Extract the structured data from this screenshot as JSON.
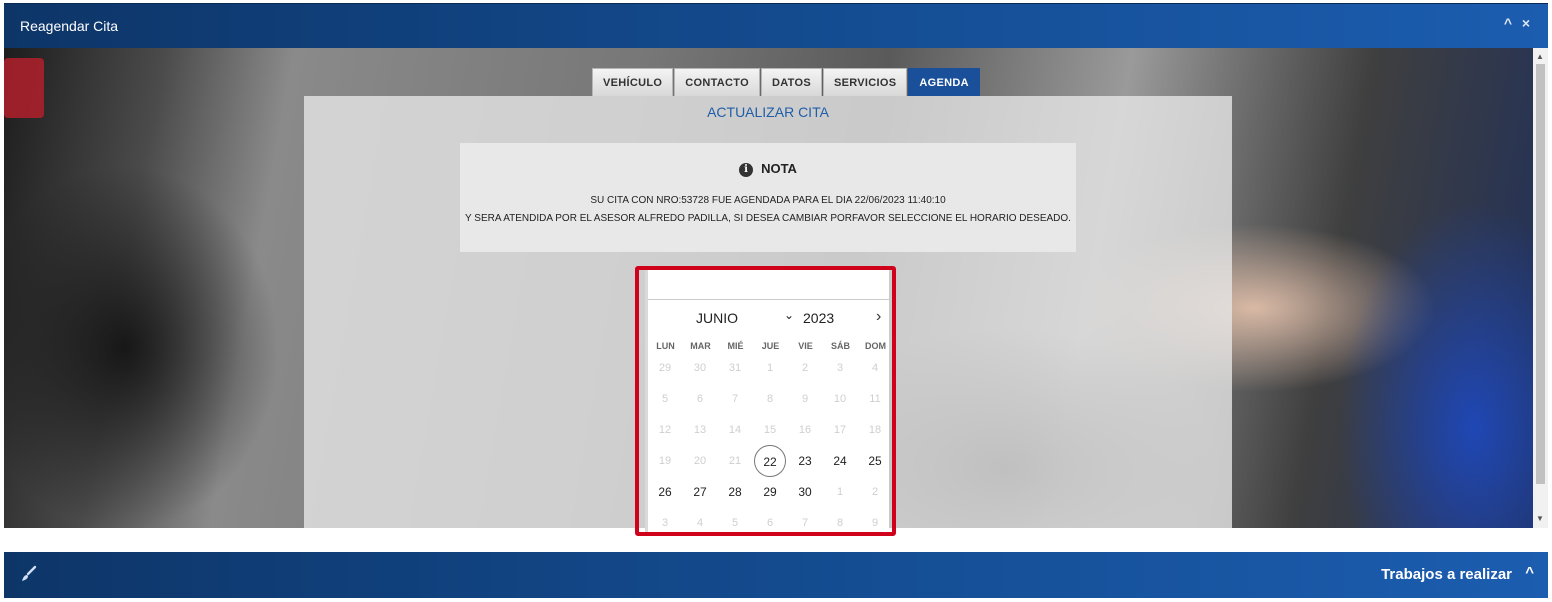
{
  "window": {
    "title": "Reagendar Cita",
    "collapse_icon": "^",
    "close_icon": "×"
  },
  "tabs": [
    {
      "label": "VEHÍCULO"
    },
    {
      "label": "CONTACTO"
    },
    {
      "label": "DATOS"
    },
    {
      "label": "SERVICIOS"
    },
    {
      "label": "AGENDA",
      "active": true
    }
  ],
  "heading": "ACTUALIZAR CITA",
  "note": {
    "icon": "i",
    "title": "NOTA",
    "line1": "SU CITA CON NRO:53728 FUE AGENDADA PARA EL DIA 22/06/2023 11:40:10",
    "line2": "Y SERA ATENDIDA POR EL ASESOR ALFREDO PADILLA, SI DESEA CAMBIAR PORFAVOR SELECCIONE EL HORARIO DESEADO."
  },
  "calendar": {
    "input_value": "",
    "month": "JUNIO",
    "year": "2023",
    "month_chevron": "⌄",
    "next_icon": "›",
    "weekdays": [
      "LUN",
      "MAR",
      "MIÉ",
      "JUE",
      "VIE",
      "SÁB",
      "DOM"
    ],
    "weeks": [
      [
        "29",
        "30",
        "31",
        "1",
        "2",
        "3",
        "4"
      ],
      [
        "5",
        "6",
        "7",
        "8",
        "9",
        "10",
        "11"
      ],
      [
        "12",
        "13",
        "14",
        "15",
        "16",
        "17",
        "18"
      ],
      [
        "19",
        "20",
        "21",
        "22",
        "23",
        "24",
        "25"
      ],
      [
        "26",
        "27",
        "28",
        "29",
        "30",
        "1",
        "2"
      ],
      [
        "3",
        "4",
        "5",
        "6",
        "7",
        "8",
        "9"
      ]
    ],
    "selected": "22"
  },
  "bottom_panel": {
    "title": "Trabajos a realizar",
    "collapse_icon": "^"
  }
}
